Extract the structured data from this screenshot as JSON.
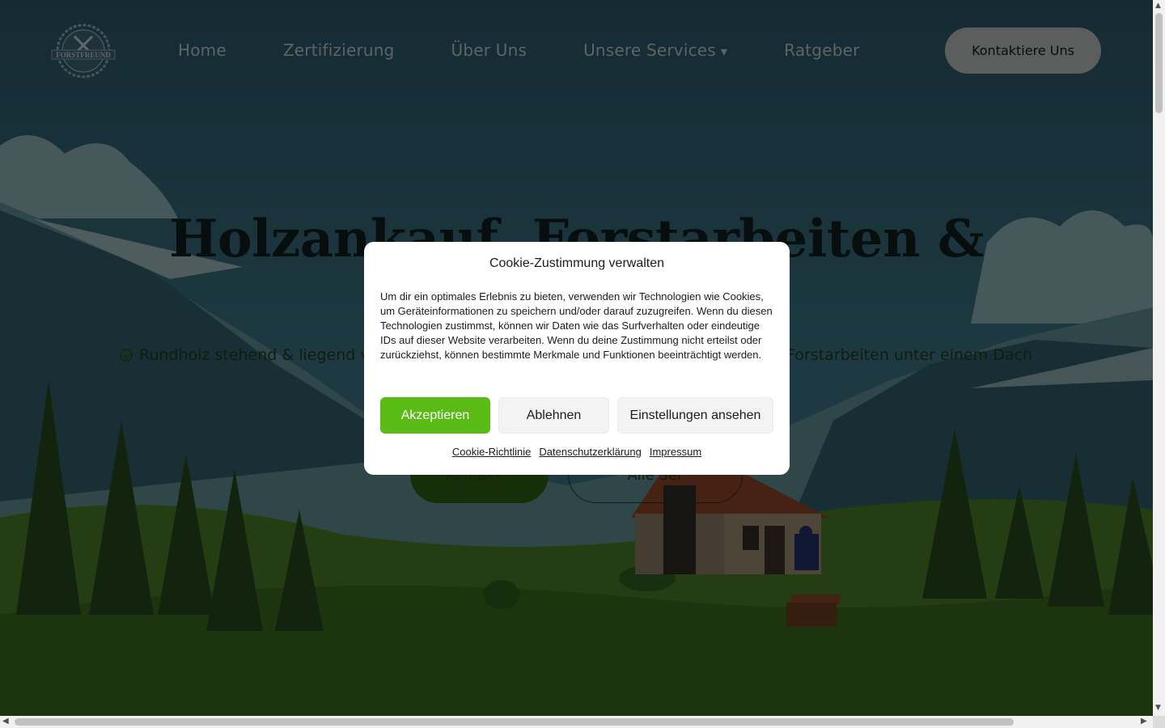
{
  "header": {
    "logo_text": "FORSTFREUND",
    "nav": [
      {
        "label": "Home"
      },
      {
        "label": "Zertifizierung"
      },
      {
        "label": "Über Uns"
      },
      {
        "label": "Unsere Services",
        "caret": "▾"
      },
      {
        "label": "Ratgeber"
      }
    ],
    "cta_label": "Kontaktiere Uns"
  },
  "hero": {
    "title": "Holzankauf, Forstarbeiten &",
    "feature_left": "Rundholz stehend & liegend verk",
    "feature_right": "e Forstarbeiten unter einem Dach",
    "primary_button": "Kontakt",
    "primary_button_icon": "›",
    "secondary_button": "Alle Ser"
  },
  "cookie_modal": {
    "title": "Cookie-Zustimmung verwalten",
    "text": "Um dir ein optimales Erlebnis zu bieten, verwenden wir Technologien wie Cookies, um Geräteinformationen zu speichern und/oder darauf zuzugreifen. Wenn du diesen Technologien zustimmst, können wir Daten wie das Surfverhalten oder eindeutige IDs auf dieser Website verarbeiten. Wenn du deine Zustimmung nicht erteilst oder zurückziehst, können bestimmte Merkmale und Funktionen beeinträchtigt werden.",
    "accept_label": "Akzeptieren",
    "deny_label": "Ablehnen",
    "preferences_label": "Einstellungen ansehen",
    "links": [
      "Cookie-Richtlinie",
      "Datenschutzerklärung",
      "Impressum"
    ]
  },
  "colors": {
    "accept": "#5aba16",
    "overlay": "rgba(0,0,0,0.5)",
    "sky": "#2c5870",
    "meadow": "#1f3a10"
  },
  "icons": {
    "logo": "axe-saw-badge-icon",
    "feature_check": "check-circle-icon",
    "scroll_up": "▲",
    "scroll_down": "▼",
    "scroll_left": "◀",
    "scroll_right": "▶"
  }
}
